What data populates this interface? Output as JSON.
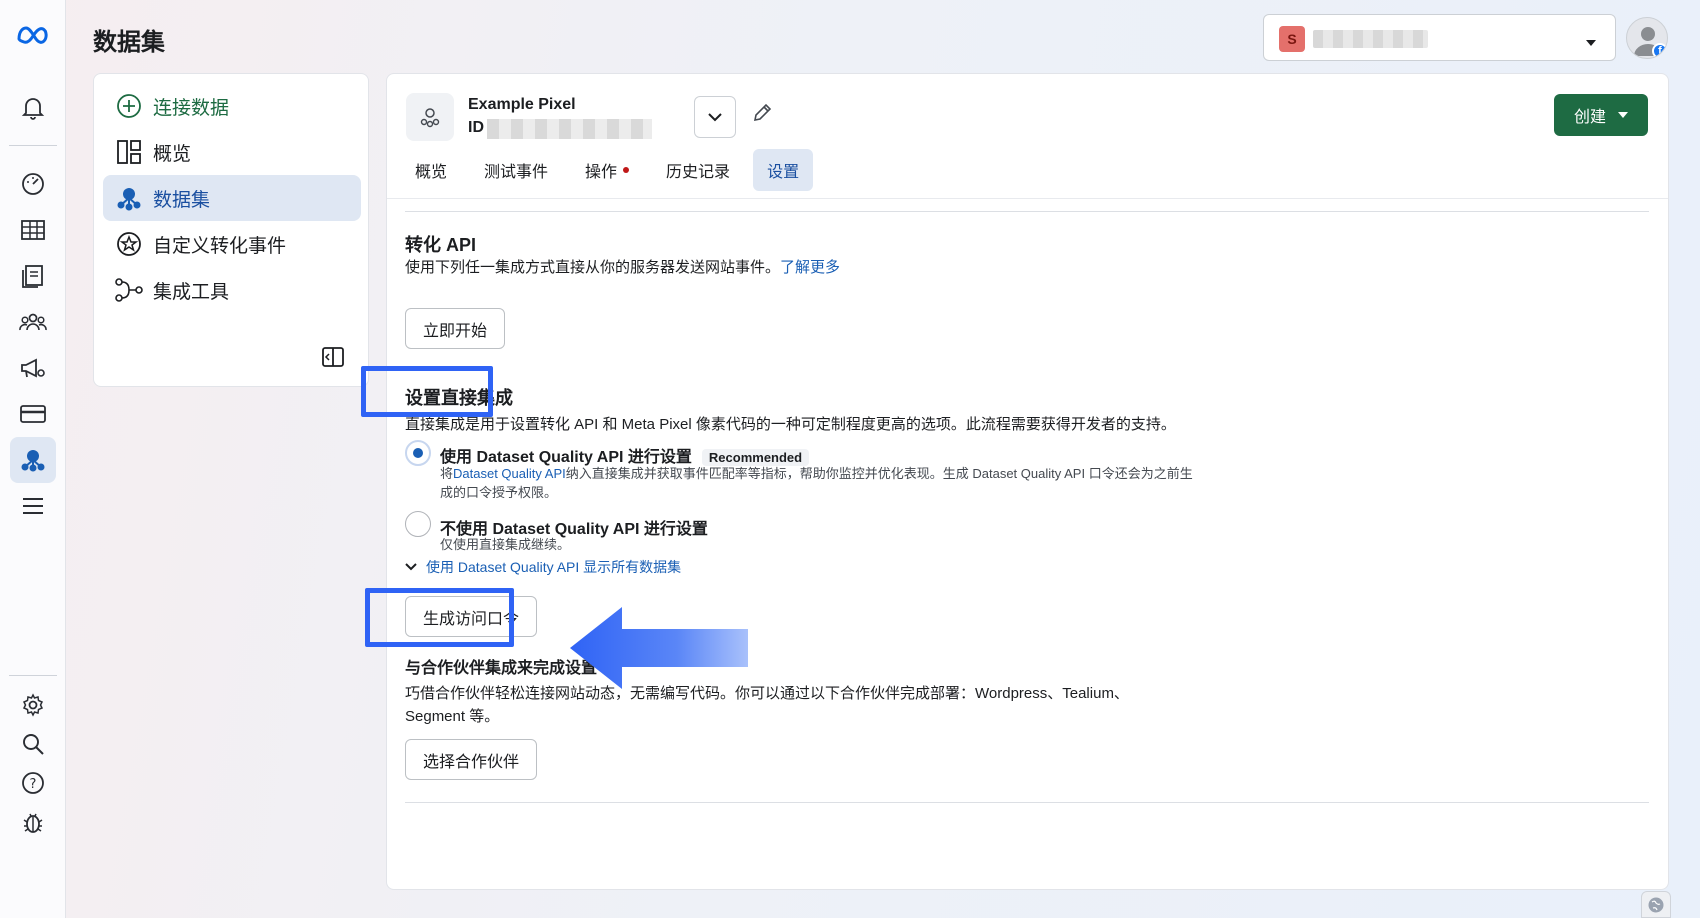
{
  "page": {
    "title": "数据集"
  },
  "account": {
    "badge": "S"
  },
  "nav": {
    "items": [
      {
        "label": "连接数据",
        "icon": "plus-circle-icon"
      },
      {
        "label": "概览",
        "icon": "overview-layout-icon"
      },
      {
        "label": "数据集",
        "icon": "dataset-icon"
      },
      {
        "label": "自定义转化事件",
        "icon": "star-circle-icon"
      },
      {
        "label": "集成工具",
        "icon": "integration-icon"
      }
    ]
  },
  "pixel": {
    "name": "Example Pixel",
    "id_label": "ID"
  },
  "tabs": [
    {
      "label": "概览"
    },
    {
      "label": "测试事件"
    },
    {
      "label": "操作"
    },
    {
      "label": "历史记录"
    },
    {
      "label": "设置"
    }
  ],
  "create_button": "创建",
  "capi": {
    "title": "转化 API",
    "desc": "使用下列任一集成方式直接从你的服务器发送网站事件。",
    "learn_more": "了解更多",
    "start_button": "立即开始"
  },
  "direct": {
    "title": "设置直接集成",
    "desc": "直接集成是用于设置转化 API 和 Meta Pixel 像素代码的一种可定制程度更高的选项。此流程需要获得开发者的支持。",
    "option1": {
      "title": "使用 Dataset Quality API 进行设置",
      "badge": "Recommended",
      "desc_prefix": "将",
      "desc_link": "Dataset Quality API",
      "desc_rest": "纳入直接集成并获取事件匹配率等指标，帮助你监控并优化表现。生成 Dataset Quality API 口令还会为之前生成的口令授予权限。"
    },
    "option2": {
      "title": "不使用 Dataset Quality API 进行设置",
      "desc": "仅使用直接集成继续。"
    },
    "expand_label": "使用 Dataset Quality API 显示所有数据集",
    "generate_button": "生成访问口令"
  },
  "partner": {
    "title": "与合作伙伴集成来完成设置",
    "desc": "巧借合作伙伴轻松连接网站动态，无需编写代码。你可以通过以下合作伙伴完成部署：Wordpress、Tealium、Segment 等。",
    "button": "选择合作伙伴"
  },
  "colors": {
    "accent": "#1a5fb4",
    "create": "#1e6b43",
    "highlight": "#2f63f5"
  }
}
